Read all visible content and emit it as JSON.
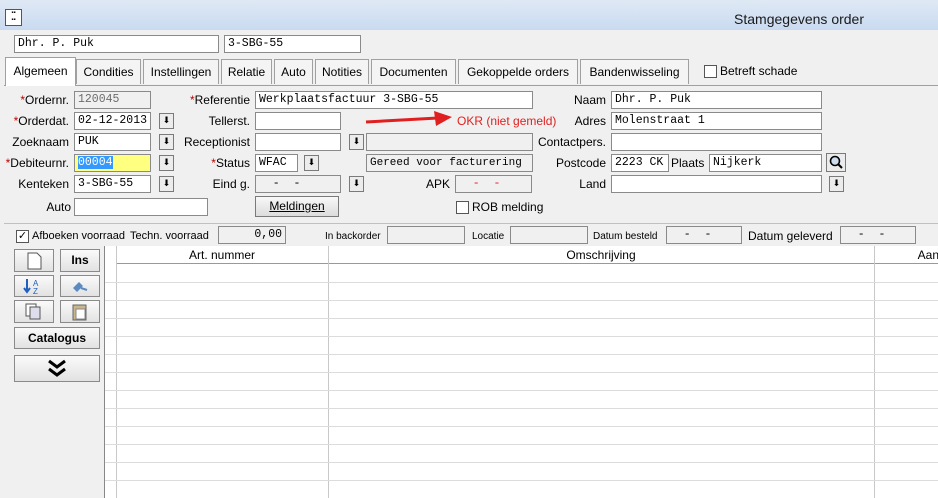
{
  "window": {
    "title": "Stamgegevens order"
  },
  "header": {
    "customer": "Dhr. P. Puk",
    "plate": "3-SBG-55"
  },
  "tabs": [
    "Algemeen",
    "Condities",
    "Instellingen",
    "Relatie",
    "Auto",
    "Notities",
    "Documenten",
    "Gekoppelde orders",
    "Bandenwisseling"
  ],
  "betreft_schade": "Betreft schade",
  "form": {
    "ordernr_label": "Ordernr.",
    "ordernr": "120045",
    "orderdat_label": "Orderdat.",
    "orderdat": "02-12-2013",
    "zoeknaam_label": "Zoeknaam",
    "zoeknaam": "PUK",
    "debiteur_label": "Debiteurnr.",
    "debiteur": "00004",
    "kenteken_label": "Kenteken",
    "kenteken": "3-SBG-55",
    "auto_label": "Auto",
    "auto": "",
    "referentie_label": "Referentie",
    "referentie": "Werkplaatsfactuur 3-SBG-55",
    "tellerst_label": "Tellerst.",
    "tellerst": "",
    "receptionist_label": "Receptionist",
    "receptionist": "",
    "status_label": "Status",
    "status": "WFAC",
    "status_text": "Gereed voor facturering",
    "eind_label": "Eind g.",
    "eind": "  -  -",
    "apk_label": "APK",
    "apk": "  -  -",
    "okr_text": "OKR (niet gemeld)",
    "meldingen": "Meldingen",
    "rob_label": "ROB melding",
    "naam_label": "Naam",
    "naam": "Dhr. P. Puk",
    "adres_label": "Adres",
    "adres": "Molenstraat 1",
    "contact_label": "Contactpers.",
    "contact": "",
    "postcode_label": "Postcode",
    "postcode": "2223 CK",
    "plaats_label": "Plaats",
    "plaats": "Nijkerk",
    "land_label": "Land",
    "land": ""
  },
  "stock": {
    "afboeken": "Afboeken voorraad",
    "techn_label": "Techn. voorraad",
    "techn": "0,00",
    "backorder_label": "In backorder",
    "locatie_label": "Locatie",
    "besteld_label": "Datum besteld",
    "besteld": "  -  -",
    "geleverd_label": "Datum geleverd",
    "geleverd": "  -  -"
  },
  "side": {
    "ins": "Ins",
    "catalogus": "Catalogus"
  },
  "grid": {
    "columns": [
      "Art. nummer",
      "Omschrijving",
      "Aan"
    ]
  },
  "colors": {
    "accent_red": "#e02020",
    "highlight_yellow": "#ffff80",
    "selection_blue": "#3399ff"
  }
}
